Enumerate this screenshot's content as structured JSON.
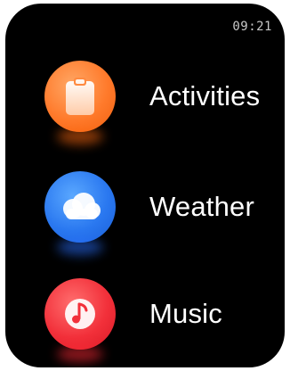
{
  "status": {
    "time": "09:21"
  },
  "menu": {
    "items": [
      {
        "label": "Activities",
        "icon": "clipboard-icon",
        "color": "#ff7a2b"
      },
      {
        "label": "Weather",
        "icon": "cloud-icon",
        "color": "#2a78f0"
      },
      {
        "label": "Music",
        "icon": "music-note-icon",
        "color": "#f2303a"
      }
    ]
  }
}
